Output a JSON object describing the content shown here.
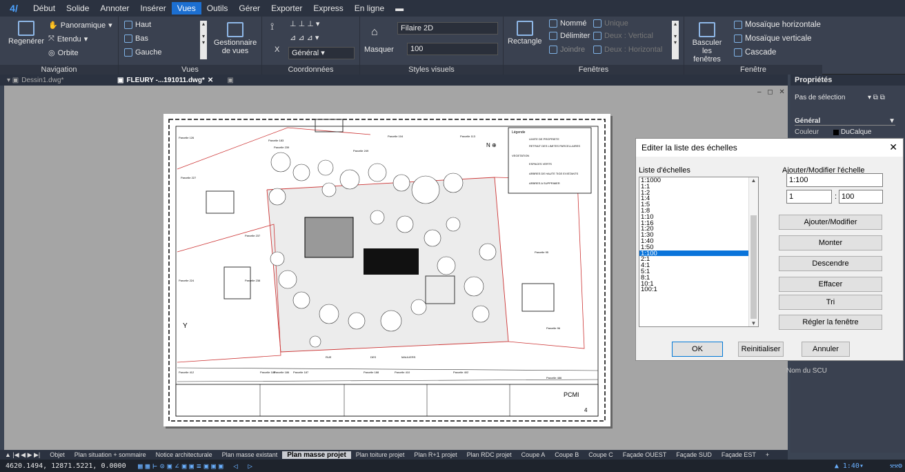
{
  "menu": [
    "Début",
    "Solide",
    "Annoter",
    "Insérer",
    "Vues",
    "Outils",
    "Gérer",
    "Exporter",
    "Express",
    "En ligne"
  ],
  "ribbon": {
    "navigation": {
      "label": "Navigation",
      "regen": "Regenérer",
      "pan": "Panoramique",
      "extent": "Etendu",
      "orbit": "Orbite"
    },
    "vues": {
      "label": "Vues",
      "haut": "Haut",
      "bas": "Bas",
      "gauche": "Gauche",
      "manager": "Gestionnaire de vues"
    },
    "coords": {
      "label": "Coordonnées",
      "x": "X",
      "general": "Général"
    },
    "styles": {
      "label": "Styles visuels",
      "mask": "Masquer",
      "style": "Filaire 2D",
      "value": "100"
    },
    "fenetres": {
      "label": "Fenêtres",
      "rect": "Rectangle",
      "named": "Nommé",
      "delimit": "Délimiter",
      "join": "Joindre",
      "unique": "Unique",
      "deux_v": "Deux : Vertical",
      "deux_h": "Deux : Horizontal"
    },
    "fenetre": {
      "label": "Fenêtre",
      "switch": "Basculer les fenêtres",
      "mosa_h": "Mosaïque horizontale",
      "mosa_v": "Mosaïque verticale",
      "cascade": "Cascade"
    }
  },
  "doc_tabs": [
    "Dessin1.dwg*",
    "FLEURY -...191011.dwg*"
  ],
  "props": {
    "title": "Propriétés",
    "selection": "Pas de sélection",
    "section": "Général",
    "color_label": "Couleur",
    "color_value": "DuCalque",
    "ucs": "Nom du SCU"
  },
  "dialog": {
    "title": "Editer la liste des échelles",
    "list_label": "Liste d'échelles",
    "modify_label": "Ajouter/Modifier l'échelle",
    "scale_name": "1:100",
    "num1": "1",
    "num2": "100",
    "scales": [
      "1:1000",
      "1:1",
      "1:2",
      "1:4",
      "1:5",
      "1:8",
      "1:10",
      "1:16",
      "1:20",
      "1:30",
      "1:40",
      "1:50",
      "1:100",
      "2:1",
      "4:1",
      "5:1",
      "8:1",
      "10:1",
      "100:1"
    ],
    "selected": "1:100",
    "buttons": [
      "Ajouter/Modifier",
      "Monter",
      "Descendre",
      "Effacer",
      "Tri",
      "Régler la fenêtre"
    ],
    "ok": "OK",
    "reset": "Reinitialiser",
    "cancel": "Annuler"
  },
  "plan": {
    "title_block": "PCMI",
    "sheet": "4",
    "street1": "RUE",
    "street2": "DES",
    "street3": "MAULIERS",
    "parcels": [
      "Parcelle 126",
      "Parcelle 183",
      "Parcelle 239",
      "Parcelle 249",
      "Parcelle 104",
      "Parcelle 113",
      "Parcelle 227",
      "Parcelle 237",
      "Parcelle 238",
      "Parcelle 95",
      "Parcelle 96",
      "Parcelle 224",
      "Parcelle 412",
      "Parcelle 185",
      "Parcelle 186",
      "Parcelle 187",
      "Parcelle 188",
      "Parcelle 410",
      "Parcelle 402",
      "Parcelle 486"
    ],
    "legend": {
      "head": "Légende",
      "limits": "LIMITE DE PROPRIETE",
      "retreat": "RETRAIT DES LIMITES PARCELLAIRES",
      "veg": "VEGETATION",
      "green": "ESPACES VERTS",
      "trees": "ARBRES DE HAUTE TIGE EXISTANTS",
      "remove": "ARBRES A SUPPRIMER"
    }
  },
  "layout_tabs": [
    "Objet",
    "Plan situation + sommaire",
    "Notice architecturale",
    "Plan masse existant",
    "Plan masse projet",
    "Plan toiture projet",
    "Plan R+1 projet",
    "Plan RDC projet",
    "Coupe A",
    "Coupe B",
    "Coupe C",
    "Façade OUEST",
    "Façade SUD",
    "Façade EST",
    "+"
  ],
  "active_layout": "Plan masse projet",
  "status": {
    "coords": "4620.1494, 12871.5221, 0.0000",
    "scale": "1:40"
  }
}
